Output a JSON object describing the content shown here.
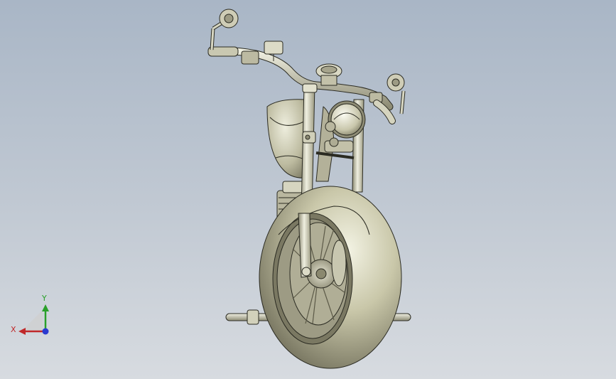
{
  "viewport": {
    "model": "motorcycle-3d-model",
    "background_top": "#a9b6c6",
    "background_bottom": "#d7dbe0"
  },
  "triad": {
    "x_label": "X",
    "y_label": "Y",
    "x_color": "#c0282a",
    "y_color": "#2aa02a",
    "z_color": "#2a3ad0"
  }
}
